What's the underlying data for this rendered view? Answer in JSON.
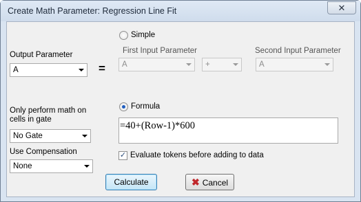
{
  "window": {
    "title": "Create Math Parameter: Regression Line Fit",
    "close_glyph": "✕"
  },
  "left": {
    "output_label": "Output Parameter",
    "output_value": "A",
    "equals": "=",
    "gate_label": "Only perform math on cells in gate",
    "gate_value": "No Gate",
    "compensation_label": "Use Compensation",
    "compensation_value": "None"
  },
  "simple": {
    "label": "Simple",
    "selected": false,
    "first_label": "First Input Parameter",
    "first_value": "A",
    "operator_value": "+",
    "second_label": "Second Input Parameter",
    "second_value": "A"
  },
  "formula": {
    "label": "Formula",
    "selected": true,
    "text": "=40+(Row-1)*600",
    "evaluate_label": "Evaluate tokens before adding to data",
    "evaluate_checked": true,
    "check_glyph": "✓"
  },
  "buttons": {
    "calculate": "Calculate",
    "cancel": "Cancel",
    "cancel_icon_glyph": "✖"
  },
  "colors": {
    "cancel_icon": "#c0262b",
    "radio_dot": "#1f5dbf"
  }
}
